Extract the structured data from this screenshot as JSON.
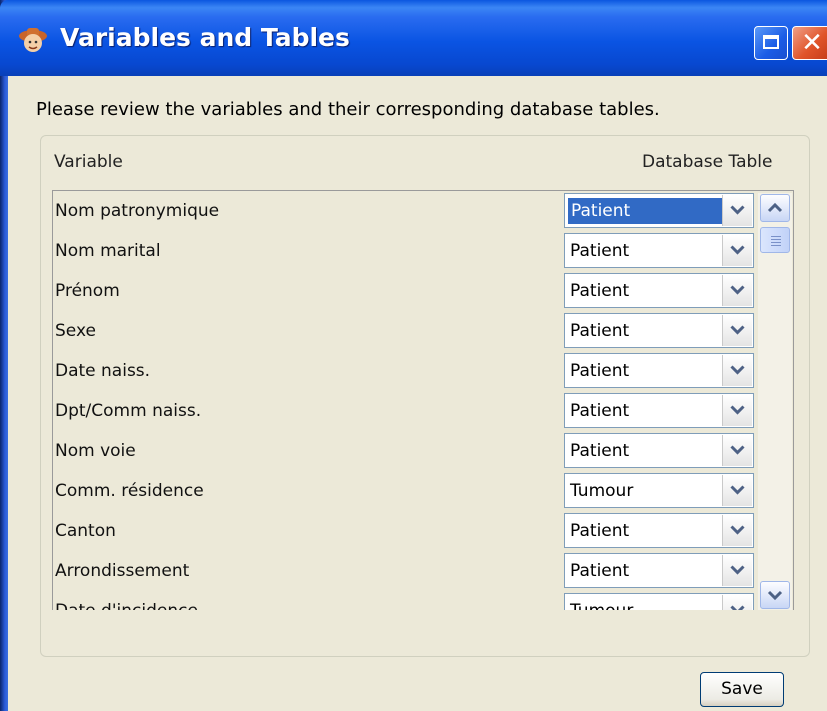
{
  "window": {
    "title": "Variables and Tables",
    "icons": {
      "app": "cowboy-app-icon",
      "maximize": "maximize-icon",
      "close": "close-icon"
    },
    "close_glyph": "✕"
  },
  "prompt": "Please review the variables and their corresponding database tables.",
  "table": {
    "headers": {
      "variable": "Variable",
      "database_table": "Database Table"
    },
    "rows": [
      {
        "variable": "Nom patronymique",
        "table": "Patient",
        "selected": true
      },
      {
        "variable": "Nom marital",
        "table": "Patient"
      },
      {
        "variable": "Prénom",
        "table": "Patient"
      },
      {
        "variable": "Sexe",
        "table": "Patient"
      },
      {
        "variable": "Date naiss.",
        "table": "Patient"
      },
      {
        "variable": "Dpt/Comm naiss.",
        "table": "Patient"
      },
      {
        "variable": "Nom voie",
        "table": "Patient"
      },
      {
        "variable": "Comm. résidence",
        "table": "Tumour"
      },
      {
        "variable": "Canton",
        "table": "Patient"
      },
      {
        "variable": "Arrondissement",
        "table": "Patient"
      },
      {
        "variable": "Date d'incidence",
        "table": "Tumour"
      }
    ]
  },
  "buttons": {
    "save": "Save"
  },
  "colors": {
    "title_bar": "#0a54e3",
    "selection": "#316ac5",
    "window_bg": "#ece9d8"
  }
}
